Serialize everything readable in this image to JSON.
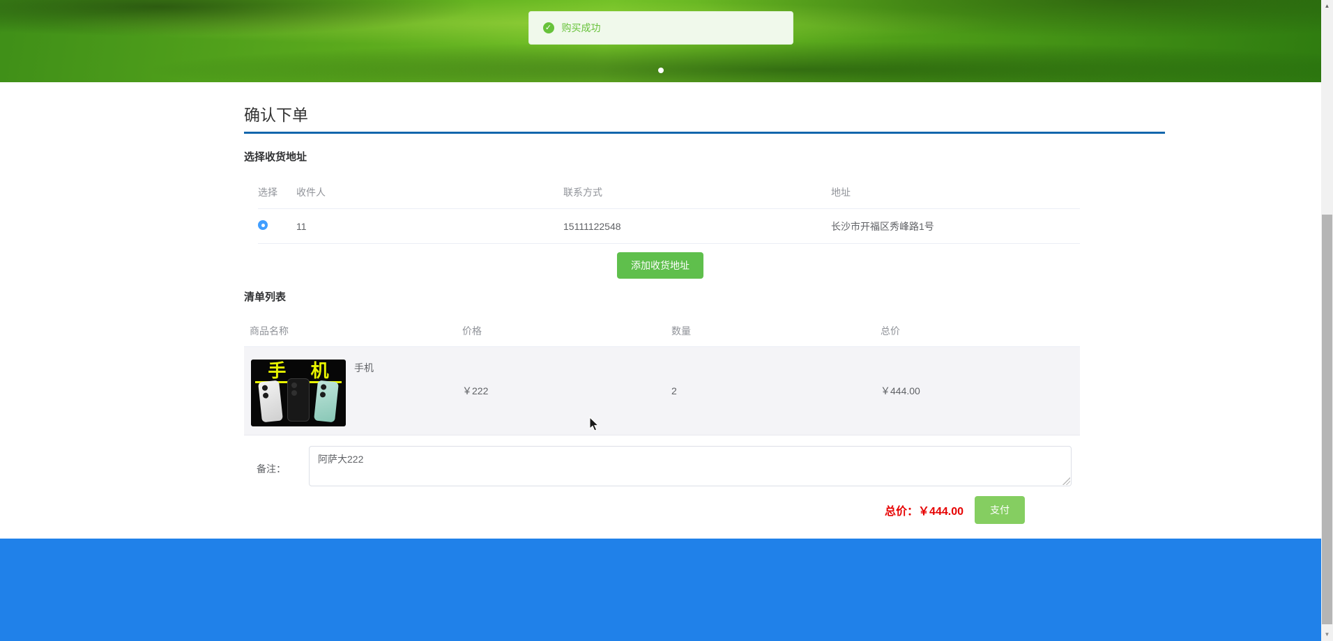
{
  "carousel": {
    "toast": {
      "icon": "check-circle",
      "message": "购买成功"
    }
  },
  "order": {
    "title": "确认下单",
    "address_section": {
      "heading": "选择收货地址",
      "columns": [
        "选择",
        "收件人",
        "联系方式",
        "地址"
      ],
      "rows": [
        {
          "selected": true,
          "recipient": "11",
          "contact": "15111122548",
          "address": "长沙市开福区秀峰路1号"
        }
      ],
      "add_button": "添加收货地址"
    },
    "cart_section": {
      "heading": "清单列表",
      "columns": [
        "商品名称",
        "价格",
        "数量",
        "总价"
      ],
      "rows": [
        {
          "name": "手机",
          "image_text": "手 机",
          "price": "￥222",
          "quantity": "2",
          "total": "￥444.00"
        }
      ]
    },
    "remark": {
      "label": "备注：",
      "value": "阿萨大222"
    },
    "summary": {
      "total_label": "总价：",
      "total_value": "￥444.00",
      "pay_button": "支付"
    }
  },
  "colors": {
    "divider_blue": "#1266ac",
    "success_green": "#67c23a",
    "add_button_green": "#5fbf4c",
    "pay_button_green": "#85ce61",
    "price_red": "#e60000",
    "footer_blue": "#2081e9",
    "radio_blue": "#409eff",
    "toast_bg": "#f0f9eb"
  }
}
